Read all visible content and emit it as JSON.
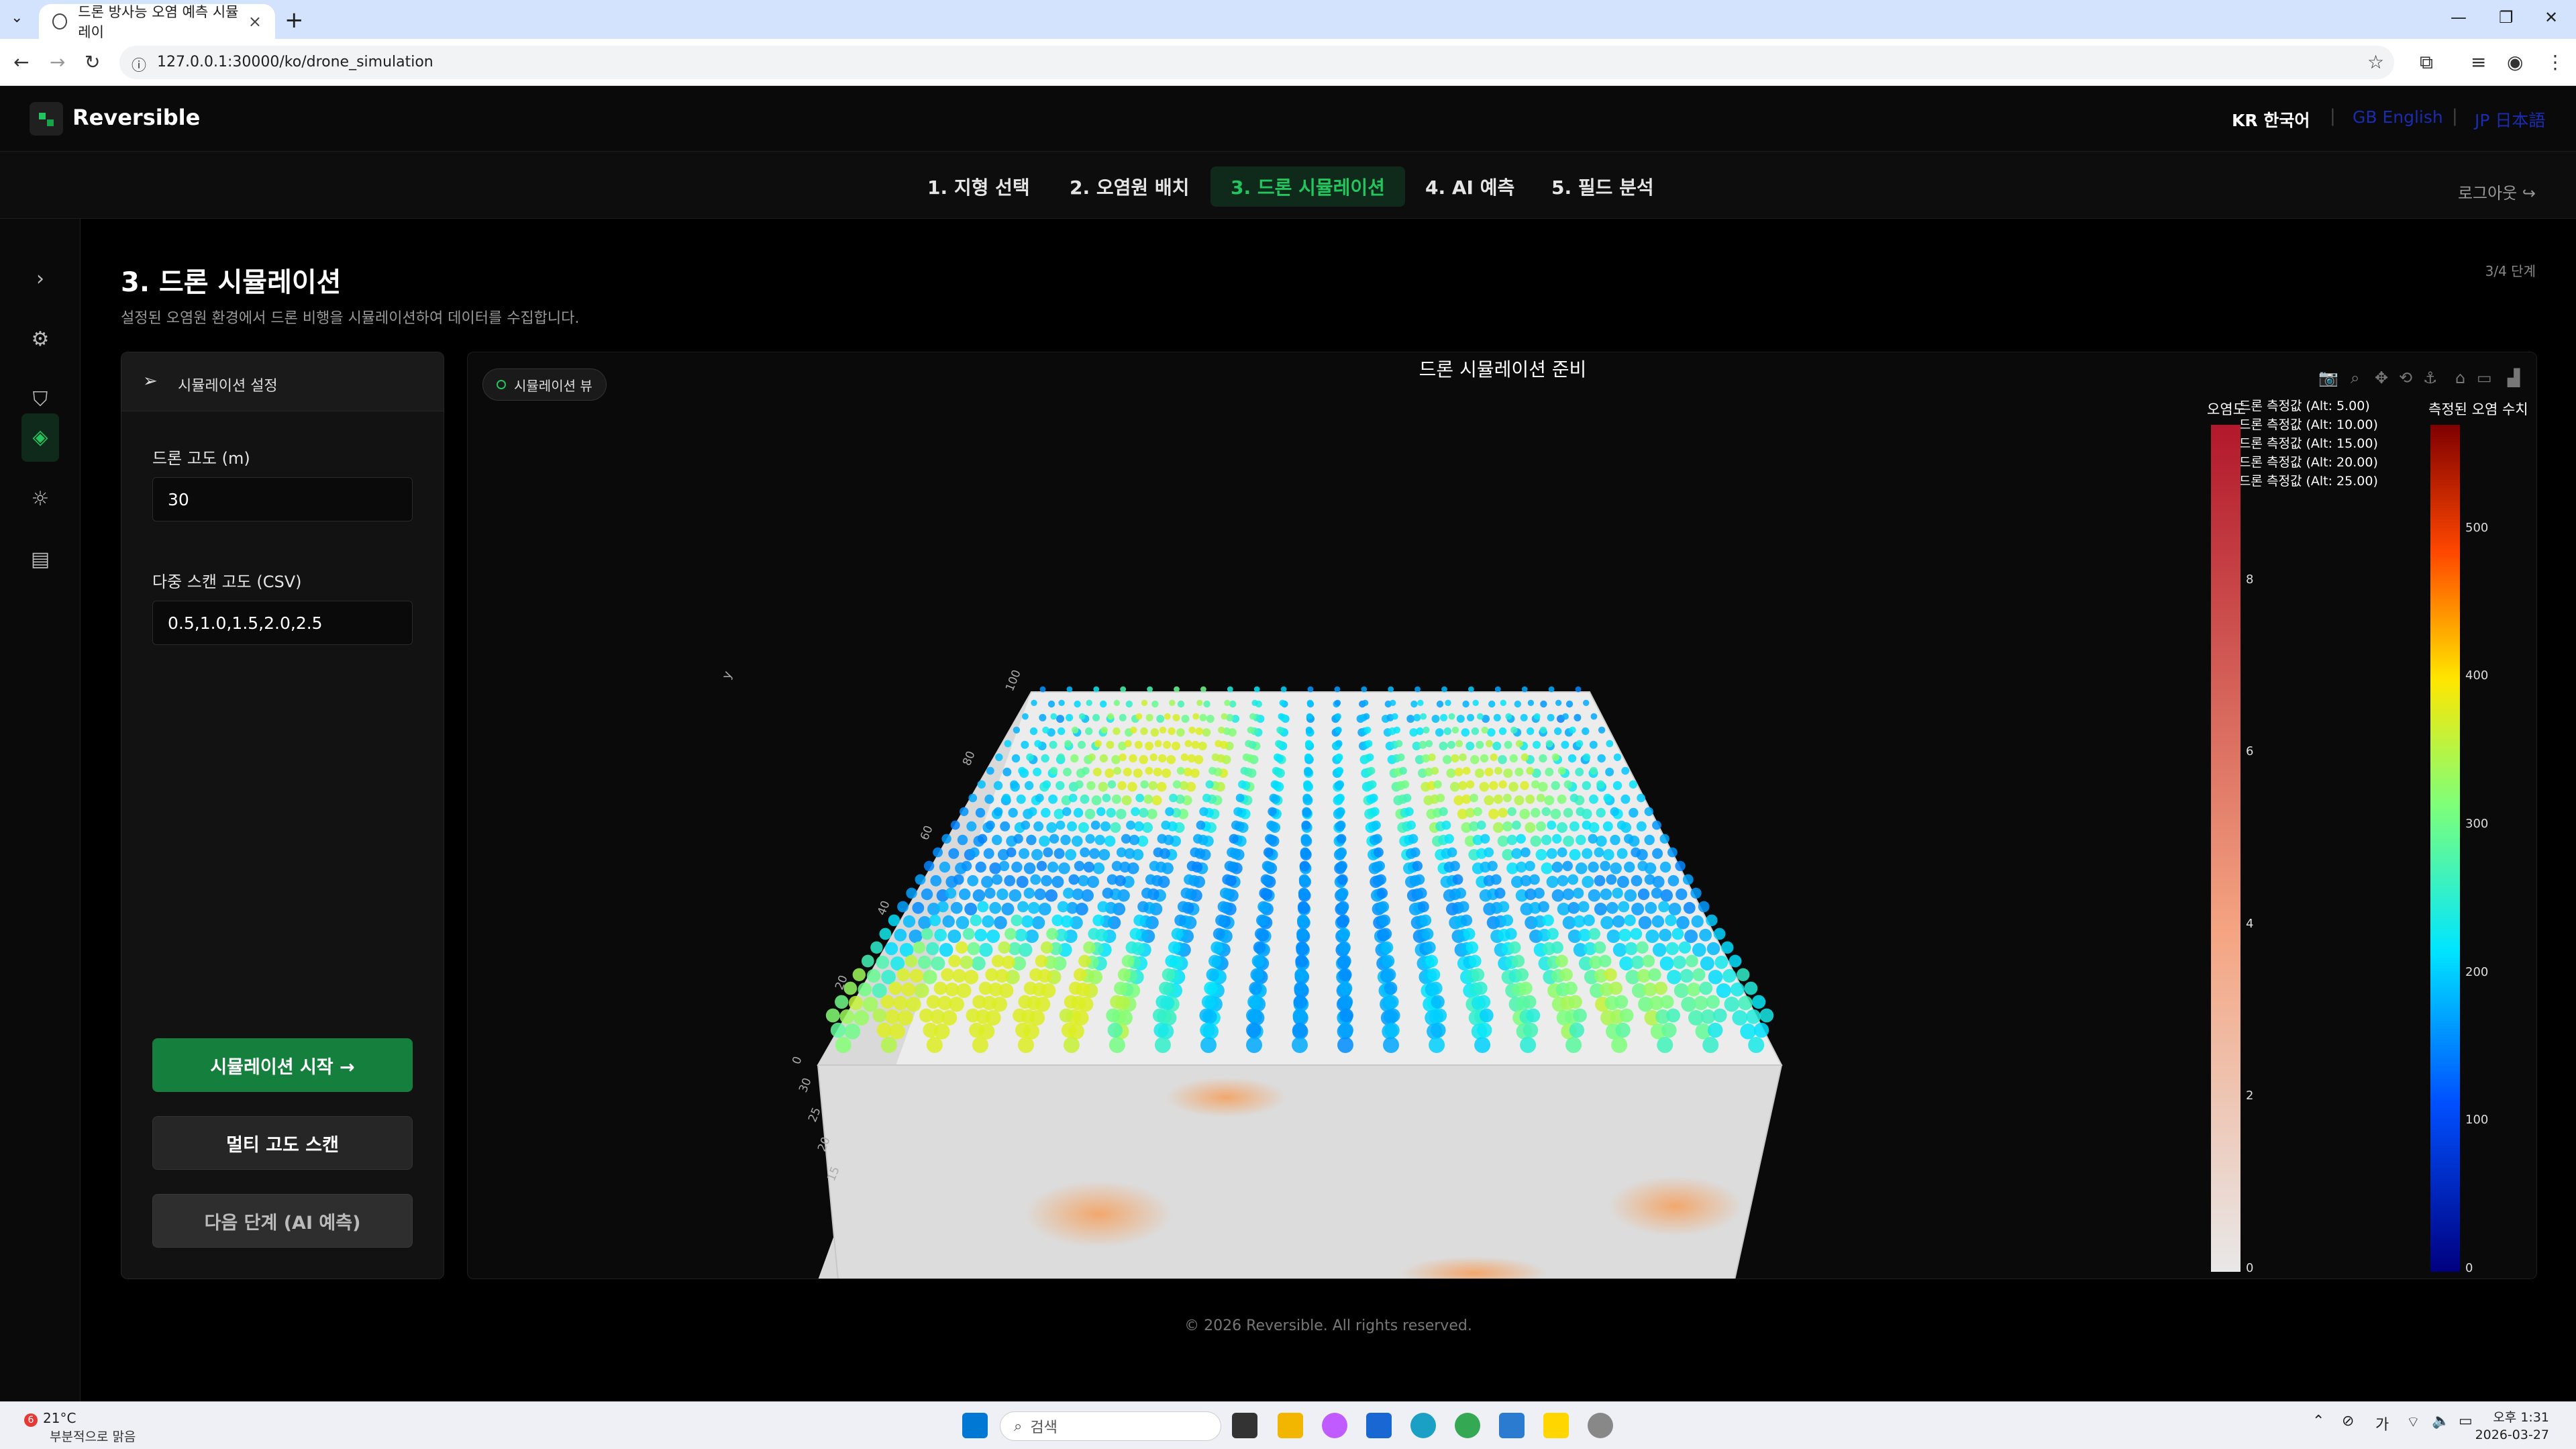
{
  "browser": {
    "tab_title": "드론 방사능 오염 예측 시뮬레이",
    "url": "127.0.0.1:30000/ko/drone_simulation"
  },
  "app": {
    "brand": "Reversible",
    "languages": {
      "ko": "KR 한국어",
      "en": "GB English",
      "ja": "JP 日本語"
    },
    "steps": [
      {
        "label": "1. 지형 선택"
      },
      {
        "label": "2. 오염원 배치"
      },
      {
        "label": "3. 드론 시뮬레이션"
      },
      {
        "label": "4. AI 예측"
      },
      {
        "label": "5. 필드 분석"
      }
    ],
    "logout": "로그아웃 ↪"
  },
  "page": {
    "title": "3. 드론 시뮬레이션",
    "subtitle": "설정된 오염원 환경에서 드론 비행을 시뮬레이션하여 데이터를 수집합니다.",
    "step_count": "3/4 단계"
  },
  "settings_panel": {
    "header": "시뮬레이션 설정",
    "altitude_label": "드론 고도 (m)",
    "altitude_value": "30",
    "multi_label": "다중 스캔 고도 (CSV)",
    "multi_value": "0.5,1.0,1.5,2.0,2.5",
    "start_button": "시뮬레이션 시작 →",
    "multi_button": "멀티 고도 스캔",
    "next_button": "다음 단계 (AI 예측)"
  },
  "viz": {
    "title": "드론 시뮬레이션 준비",
    "badge": "시뮬레이션 뷰",
    "legend_series": [
      "드론 측정값 (Alt: 5.00)",
      "드론 측정값 (Alt: 10.00)",
      "드론 측정값 (Alt: 15.00)",
      "드론 측정값 (Alt: 20.00)",
      "드론 측정값 (Alt: 25.00)"
    ],
    "colorbar1_title": "오염도",
    "colorbar1_ticks": [
      "0",
      "2",
      "4",
      "6",
      "8"
    ],
    "colorbar2_title": "측정된 오염 수치",
    "colorbar2_ticks": [
      "0",
      "100",
      "200",
      "300",
      "400",
      "500"
    ],
    "y_axis_label": "y",
    "y_ticks": [
      "0",
      "20",
      "40",
      "60",
      "80",
      "100"
    ],
    "z_ticks": [
      "15",
      "20",
      "25",
      "30"
    ]
  },
  "footer": "© 2026 Reversible. All rights reserved.",
  "taskbar": {
    "temp": "21°C",
    "weather": "부분적으로 맑음",
    "weather_badge": "6",
    "search": "검색",
    "time": "오후 1:31",
    "date": "2026-03-27",
    "ime": "가"
  },
  "chart_data": {
    "type": "scatter",
    "title": "드론 시뮬레이션 준비",
    "ylabel": "y",
    "series_names": [
      "드론 측정값 (Alt: 5.00)",
      "드론 측정값 (Alt: 10.00)",
      "드론 측정값 (Alt: 15.00)",
      "드론 측정값 (Alt: 20.00)",
      "드론 측정값 (Alt: 25.00)"
    ],
    "colorbar_range": [
      0,
      550
    ],
    "surface_colorbar_range": [
      0,
      10
    ],
    "y_range": [
      0,
      100
    ]
  }
}
